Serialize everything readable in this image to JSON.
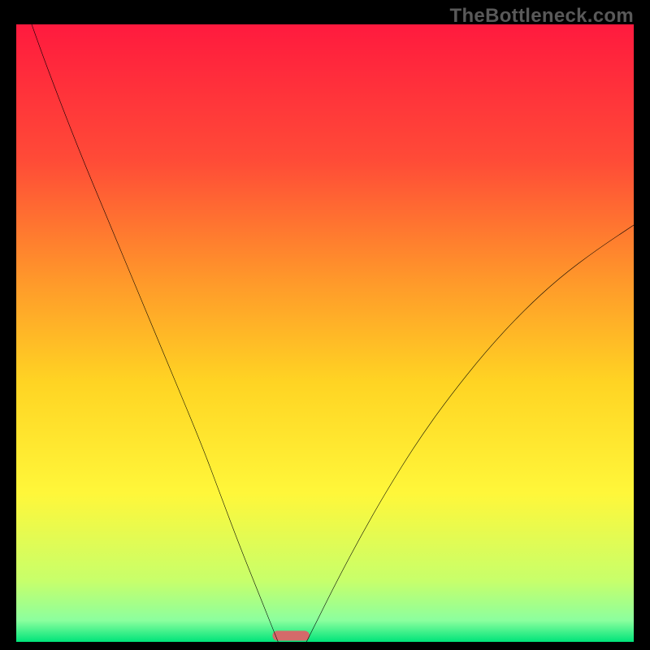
{
  "watermark": "TheBottleneck.com",
  "chart_data": {
    "type": "line",
    "title": "",
    "xlabel": "",
    "ylabel": "",
    "xlim": [
      0,
      100
    ],
    "ylim": [
      0,
      100
    ],
    "grid": false,
    "annotations": [],
    "background_gradient": {
      "kind": "vertical",
      "stops": [
        {
          "pos": 0.0,
          "color": "#ff1a3e"
        },
        {
          "pos": 0.22,
          "color": "#ff4b37"
        },
        {
          "pos": 0.42,
          "color": "#ff9a2a"
        },
        {
          "pos": 0.58,
          "color": "#ffd423"
        },
        {
          "pos": 0.76,
          "color": "#fff73a"
        },
        {
          "pos": 0.9,
          "color": "#c8ff6a"
        },
        {
          "pos": 0.965,
          "color": "#8cff9e"
        },
        {
          "pos": 1.0,
          "color": "#00e47a"
        }
      ]
    },
    "optimal_marker": {
      "x": 44.5,
      "width": 6,
      "color": "#d46a6a"
    },
    "series": [
      {
        "name": "left-curve",
        "x": [
          2.5,
          5,
          10,
          15,
          20,
          25,
          30,
          33,
          36,
          39,
          41,
          42.4
        ],
        "y": [
          100,
          93,
          80,
          68,
          56,
          44,
          32,
          24,
          16,
          8.5,
          3.5,
          0
        ],
        "stroke": "#000000",
        "stroke_width": 2
      },
      {
        "name": "right-curve",
        "x": [
          47,
          49,
          52,
          56,
          60,
          65,
          70,
          76,
          82,
          88,
          94,
          100
        ],
        "y": [
          0,
          4,
          10,
          17.5,
          24.5,
          32.5,
          39.5,
          47,
          53.5,
          59,
          63.5,
          67.5
        ],
        "stroke": "#000000",
        "stroke_width": 2
      }
    ]
  }
}
